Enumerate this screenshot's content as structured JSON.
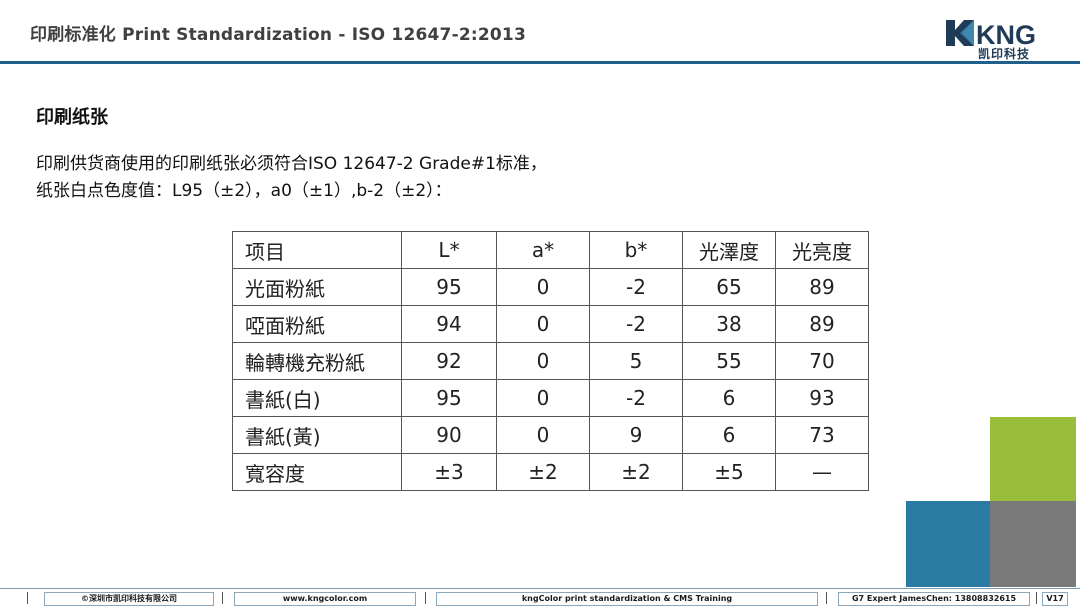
{
  "header": {
    "title": "印刷标准化 Print Standardization - ISO 12647-2:2013",
    "logo_text": "KNG",
    "logo_subtext": "凯印科技"
  },
  "section": {
    "heading": "印刷纸张",
    "body_line1": "印刷供货商使用的印刷纸张必须符合ISO 12647-2 Grade#1标准，",
    "body_line2": "纸张白点色度值：L95（±2），a0（±1）,b-2（±2）："
  },
  "table": {
    "headers": [
      "项目",
      "L*",
      "a*",
      "b*",
      "光澤度",
      "光亮度"
    ],
    "rows": [
      [
        "光面粉紙",
        "95",
        "0",
        "-2",
        "65",
        "89"
      ],
      [
        "啞面粉紙",
        "94",
        "0",
        "-2",
        "38",
        "89"
      ],
      [
        "輪轉機充粉紙",
        "92",
        "0",
        "5",
        "55",
        "70"
      ],
      [
        "書紙(白)",
        "95",
        "0",
        "-2",
        "6",
        "93"
      ],
      [
        "書紙(黃)",
        "90",
        "0",
        "9",
        "6",
        "73"
      ],
      [
        "寬容度",
        "±3",
        "±2",
        "±2",
        "±5",
        "—"
      ]
    ]
  },
  "footer": {
    "company": "©深圳市凯印科技有限公司",
    "website": "www.kngcolor.com",
    "training": "kngColor print standardization & CMS Training",
    "expert": "G7 Expert JamesChen: 13808832615",
    "version": "V17"
  },
  "colors": {
    "title_gray": "#404040",
    "header_rule_blue": "#1f5f8b",
    "logo_navy": "#1f3b57",
    "deco_green": "#9abe3c",
    "deco_blue": "#2a7aa3",
    "deco_gray": "#7a7a7a"
  }
}
